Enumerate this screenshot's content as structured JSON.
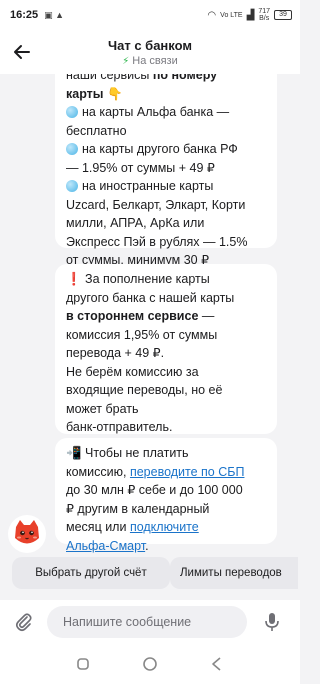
{
  "status_bar": {
    "time": "16:25",
    "network": "Vo LTE",
    "network_sub": "LTE",
    "speed": "717",
    "speed_unit": "B/s",
    "battery": "39"
  },
  "header": {
    "title": "Чат с банком",
    "status": "На связи"
  },
  "messages": [
    {
      "lines": [
        {
          "pre": "наши сервисы ",
          "bold": "по номеру",
          "post": ""
        },
        {
          "pre": "",
          "bold": "карты",
          "post": " 👇"
        },
        {
          "dot": true,
          "pre": "на карты Альфа банка —",
          "bold": "",
          "post": ""
        },
        {
          "pre": "бесплатно",
          "bold": "",
          "post": ""
        },
        {
          "dot": true,
          "pre": "на карты другого банка РФ",
          "bold": "",
          "post": ""
        },
        {
          "pre": "— 1.95% от суммы + 49 ₽",
          "bold": "",
          "post": ""
        },
        {
          "dot": true,
          "pre": "на иностранные карты",
          "bold": "",
          "post": ""
        },
        {
          "pre": "Uzcard, Белкарт, Элкарт, Корти",
          "bold": "",
          "post": ""
        },
        {
          "pre": "милли, АПРА, АрКа или",
          "bold": "",
          "post": ""
        },
        {
          "pre": "Экспресс Пэй в рублях — 1.5%",
          "bold": "",
          "post": ""
        },
        {
          "pre": "от суммы, минимум 30 ₽",
          "bold": "",
          "post": ""
        }
      ]
    },
    {
      "lines": [
        {
          "pre": "❗ За пополнение карты",
          "bold": "",
          "post": ""
        },
        {
          "pre": "другого банка с нашей карты",
          "bold": "",
          "post": ""
        },
        {
          "pre": "",
          "bold": "в стороннем сервисе",
          "post": " —"
        },
        {
          "pre": "комиссия 1,95% от суммы",
          "bold": "",
          "post": ""
        },
        {
          "pre": "перевода + 49 ₽.",
          "bold": "",
          "post": ""
        },
        {
          "pre": "Не берём комиссию за",
          "bold": "",
          "post": ""
        },
        {
          "pre": "входящие переводы, но её",
          "bold": "",
          "post": ""
        },
        {
          "pre": "может брать",
          "bold": "",
          "post": ""
        },
        {
          "pre": "банк-отправитель.",
          "bold": "",
          "post": ""
        }
      ]
    },
    {
      "lines": [
        {
          "pre": "📲 Чтобы не платить",
          "bold": "",
          "post": ""
        },
        {
          "pre": "комиссию, ",
          "link": "переводите по СБП",
          "post": ""
        },
        {
          "pre": "до 30 млн ₽ себе и до 100 000",
          "bold": "",
          "post": ""
        },
        {
          "pre": "₽ другим в календарный",
          "bold": "",
          "post": ""
        },
        {
          "pre": "месяц или ",
          "link": "подключите",
          "post": ""
        },
        {
          "pre": "",
          "link": "Альфа-Смарт",
          "post": "."
        }
      ]
    }
  ],
  "quick_replies": [
    "Выбрать другой счёт",
    "Лимиты переводов"
  ],
  "composer": {
    "placeholder": "Напишите сообщение"
  },
  "icons": {
    "back": "back-arrow-icon",
    "status": "lightning-icon",
    "attach": "paperclip-icon",
    "mic": "microphone-icon",
    "avatar": "bank-bot-cat-icon"
  },
  "colors": {
    "link": "#1a73c9",
    "online": "#2ab54a",
    "bubble": "#ffffff",
    "background": "#f3f3f5",
    "avatar_accent": "#e8402a"
  }
}
